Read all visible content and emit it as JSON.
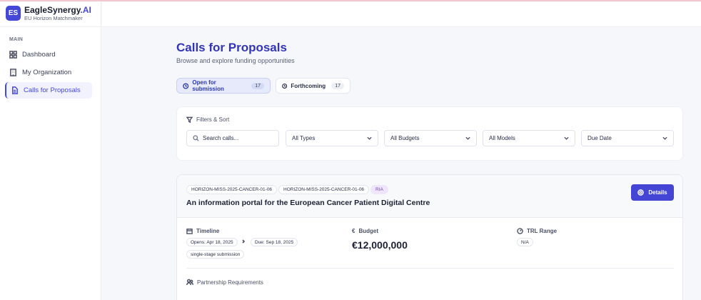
{
  "brand": {
    "logo": "ES",
    "name": "EagleSynergy",
    "name_suffix": ".AI",
    "subtitle": "EU Horizon Matchmaker",
    "accent": "#4547d6"
  },
  "sidebar": {
    "section": "MAIN",
    "items": [
      {
        "label": "Dashboard",
        "icon": "grid-icon",
        "active": false
      },
      {
        "label": "My Organization",
        "icon": "building-icon",
        "active": false
      },
      {
        "label": "Calls for Proposals",
        "icon": "document-icon",
        "active": true
      }
    ]
  },
  "page": {
    "title": "Calls for Proposals",
    "subtitle": "Browse and explore funding opportunities"
  },
  "tabs": [
    {
      "label": "Open for submission",
      "count": "17",
      "icon": "clock-icon",
      "active": true
    },
    {
      "label": "Forthcoming",
      "count": "17",
      "icon": "clock-icon",
      "active": false
    }
  ],
  "filters": {
    "title": "Filters & Sort",
    "search_placeholder": "Search calls...",
    "selects": [
      "All Types",
      "All Budgets",
      "All Models",
      "Due Date"
    ]
  },
  "card": {
    "tags": [
      "HORIZON-MISS-2025-CANCER-01-06",
      "HORIZON-MISS-2025-CANCER-01-06",
      "RIA"
    ],
    "title": "An information portal for the European Cancer Patient Digital Centre",
    "details_label": "Details",
    "timeline": {
      "label": "Timeline",
      "opens": "Opens: Apr 18, 2025",
      "due": "Due: Sep 18, 2025",
      "submission": "single-stage submission"
    },
    "budget": {
      "label": "Budget",
      "value": "€12,000,000",
      "icon_glyph": "€"
    },
    "trl": {
      "label": "TRL Range",
      "value": "N/A"
    },
    "partnership_label": "Partnership Requirements"
  }
}
